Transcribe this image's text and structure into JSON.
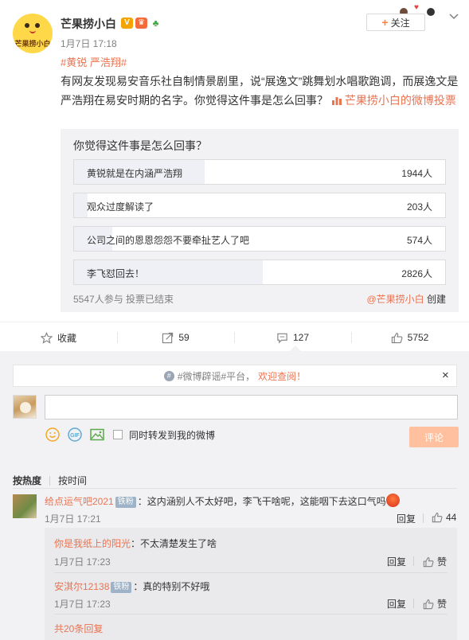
{
  "post": {
    "user_name": "芒果捞小白",
    "avatar_text": "芒果捞小白",
    "time": "1月7日 17:18",
    "follow_label": "关注",
    "hashtags": "#黄锐 严浩翔#",
    "text": "有网友发现易安音乐社自制情景剧里，说“展逸文”跳舞划水唱歌跑调，而展逸文是严浩翔在易安时期的名字。你觉得这件事是怎么回事？ ",
    "vote_link": "芒果捞小白的微博投票",
    "badge_icons": [
      "verified-icon",
      "vip-crown-icon",
      "plant-icon"
    ]
  },
  "poll": {
    "question": "你觉得这件事是怎么回事？",
    "options": [
      {
        "label": "黄锐就是在内涵严浩翔",
        "count": "1944人",
        "share": 0.352
      },
      {
        "label": "观众过度解读了",
        "count": "203人",
        "share": 0.037
      },
      {
        "label": "公司之间的恩恩怨怨不要牵扯艺人了吧",
        "count": "574人",
        "share": 0.104
      },
      {
        "label": "李飞怼回去！",
        "count": "2826人",
        "share": 0.508
      }
    ],
    "footer": "5547人参与 投票已结束",
    "creator_name": "@芒果捞小白",
    "creator_suffix": " 创建"
  },
  "actions": {
    "favorite": "收藏",
    "repost": "59",
    "comment": "127",
    "like": "5752"
  },
  "comment_box": {
    "notice_prefix": "#微博辟谣#平台，",
    "notice_link": "欢迎查阅！",
    "close": "×",
    "sync_label": "同时转发到我的微博",
    "submit_label": "评论"
  },
  "sort": {
    "by_hot": "按热度",
    "by_time": "按时间"
  },
  "comments": [
    {
      "user": "给点运气吧2021",
      "fan_badge": "铁粉",
      "text": "：这内涵别人不太好吧，李飞干啥呢，这能咽下去这口气吗",
      "time": "1月7日 17:21",
      "reply": "回复",
      "likes": "44"
    }
  ],
  "sub_replies": [
    {
      "user": "你是我纸上的阳光",
      "fan_badge": "",
      "text": "：不太清楚发生了啥",
      "time": "1月7日 17:23",
      "reply": "回复",
      "likes": "赞"
    },
    {
      "user": "安淇尔12138",
      "fan_badge": "铁粉",
      "text": "：真的特别不好哦",
      "time": "1月7日 17:23",
      "reply": "回复",
      "likes": "赞"
    }
  ],
  "more_replies": "共20条回复",
  "colors": {
    "accent": "#eb7350",
    "poll_bg": "#f2f2f5",
    "submit_disabled": "#ffc09f",
    "fan_badge": "#9fb3c8"
  }
}
